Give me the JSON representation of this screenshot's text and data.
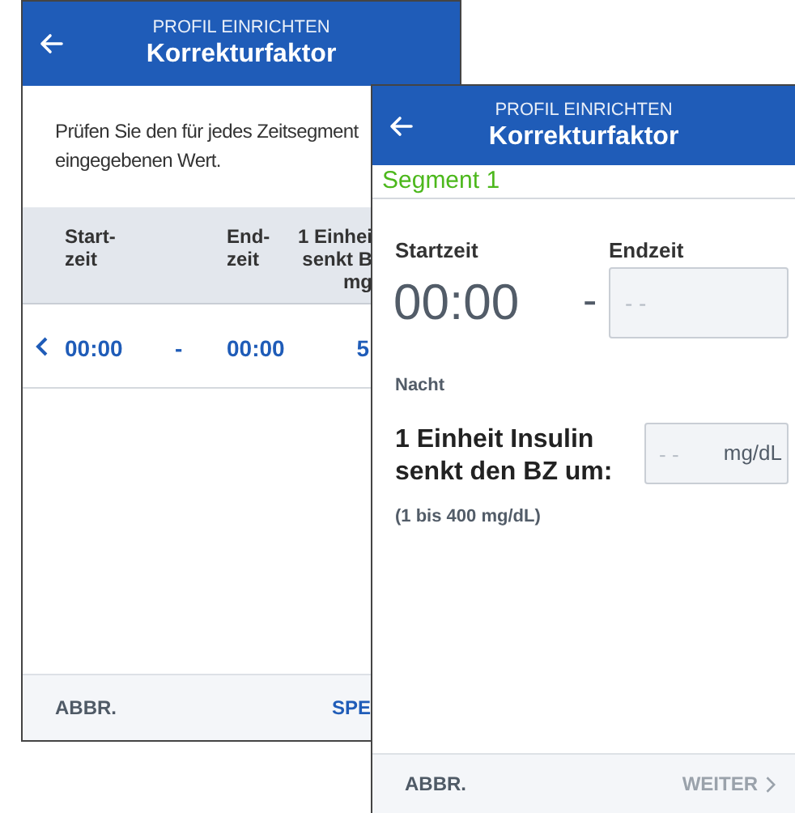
{
  "screens": [
    {
      "header": {
        "subtitle": "PROFIL EINRICHTEN",
        "title": "Korrekturfaktor"
      },
      "intro": "Prüfen Sie den für jedes Zeitsegment\neingegebenen Wert.",
      "table": {
        "columns": [
          "Start-\nzeit",
          "End-\nzeit",
          "1 Einhei\nsenkt B\nmg"
        ],
        "rows": [
          {
            "start": "00:00",
            "separator": "-",
            "end": "00:00",
            "value": "5"
          }
        ]
      },
      "footer": {
        "cancel": "ABBR.",
        "confirm": "SPE",
        "confirm_disabled": false
      }
    },
    {
      "header": {
        "subtitle": "PROFIL EINRICHTEN",
        "title": "Korrekturfaktor"
      },
      "segment": "Segment 1",
      "start_label": "Startzeit",
      "end_label": "Endzeit",
      "start_time": "00:00",
      "separator": "-",
      "end_placeholder": "- -",
      "period": "Nacht",
      "factor_label": "1 Einheit Insulin\nsenkt den BZ um:",
      "factor_placeholder": "- -",
      "factor_unit": "mg/dL",
      "range": "(1 bis 400 mg/dL)",
      "footer": {
        "cancel": "ABBR.",
        "confirm": "WEITER",
        "confirm_disabled": true
      }
    }
  ]
}
